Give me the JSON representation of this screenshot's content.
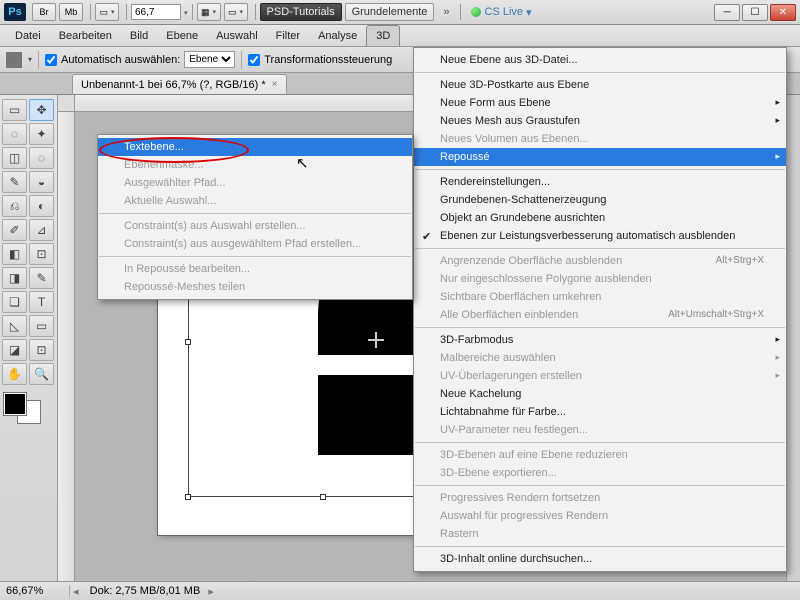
{
  "titlebar": {
    "zoom": "66,7",
    "service1": "PSD-Tutorials",
    "service2": "Grundelemente",
    "cslive": "CS Live"
  },
  "menubar": [
    "Datei",
    "Bearbeiten",
    "Bild",
    "Ebene",
    "Auswahl",
    "Filter",
    "Analyse",
    "3D"
  ],
  "optbar": {
    "auto_select": "Automatisch auswählen:",
    "auto_select_value": "Ebene",
    "transform": "Transformationssteuerung"
  },
  "doctab": {
    "title": "Unbenannt-1 bei 66,7% (?, RGB/16) *"
  },
  "statusbar": {
    "zoom": "66,67%",
    "dok": "Dok: 2,75 MB/8,01 MB"
  },
  "menu3d": {
    "items": [
      {
        "label": "Neue Ebene aus 3D-Datei..."
      },
      "sep",
      {
        "label": "Neue 3D-Postkarte aus Ebene"
      },
      {
        "label": "Neue Form aus Ebene",
        "sub": true
      },
      {
        "label": "Neues Mesh aus Graustufen",
        "sub": true
      },
      {
        "label": "Neues Volumen aus Ebenen...",
        "disabled": true
      },
      {
        "label": "Repoussé",
        "sub": true,
        "hi": true
      },
      "sep",
      {
        "label": "Rendereinstellungen..."
      },
      {
        "label": "Grundebenen-Schattenerzeugung"
      },
      {
        "label": "Objekt an Grundebene ausrichten"
      },
      {
        "label": "Ebenen zur Leistungsverbesserung automatisch ausblenden",
        "check": true
      },
      "sep",
      {
        "label": "Angrenzende Oberfläche ausblenden",
        "shortcut": "Alt+Strg+X",
        "disabled": true
      },
      {
        "label": "Nur eingeschlossene Polygone ausblenden",
        "disabled": true
      },
      {
        "label": "Sichtbare Oberflächen umkehren",
        "disabled": true
      },
      {
        "label": "Alle Oberflächen einblenden",
        "shortcut": "Alt+Umschalt+Strg+X",
        "disabled": true
      },
      "sep",
      {
        "label": "3D-Farbmodus",
        "sub": true
      },
      {
        "label": "Malbereiche auswählen",
        "sub": true,
        "disabled": true
      },
      {
        "label": "UV-Überlagerungen erstellen",
        "sub": true,
        "disabled": true
      },
      {
        "label": "Neue Kachelung"
      },
      {
        "label": "Lichtabnahme für Farbe..."
      },
      {
        "label": "UV-Parameter neu festlegen...",
        "disabled": true
      },
      "sep",
      {
        "label": "3D-Ebenen auf eine Ebene reduzieren",
        "disabled": true
      },
      {
        "label": "3D-Ebene exportieren...",
        "disabled": true
      },
      "sep",
      {
        "label": "Progressives Rendern fortsetzen",
        "disabled": true
      },
      {
        "label": "Auswahl für progressives Rendern",
        "disabled": true
      },
      {
        "label": "Rastern",
        "disabled": true
      },
      "sep",
      {
        "label": "3D-Inhalt online durchsuchen..."
      }
    ]
  },
  "repousse": {
    "items": [
      {
        "label": "Textebene...",
        "hi": true
      },
      {
        "label": "Ebenenmaske...",
        "disabled": true
      },
      {
        "label": "Ausgewählter Pfad...",
        "disabled": true
      },
      {
        "label": "Aktuelle Auswahl...",
        "disabled": true
      },
      "sep",
      {
        "label": "Constraint(s) aus Auswahl erstellen...",
        "disabled": true
      },
      {
        "label": "Constraint(s) aus ausgewähltem Pfad erstellen...",
        "disabled": true
      },
      "sep",
      {
        "label": "In Repoussé bearbeiten...",
        "disabled": true
      },
      {
        "label": "Repoussé-Meshes teilen",
        "disabled": true
      }
    ]
  }
}
